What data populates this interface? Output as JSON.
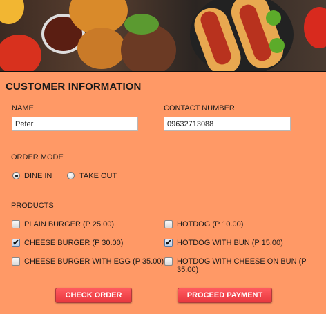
{
  "header": {
    "title": "CUSTOMER INFORMATION"
  },
  "name": {
    "label": "NAME",
    "value": "Peter"
  },
  "contact": {
    "label": "CONTACT NUMBER",
    "value": "09632713088"
  },
  "order_mode": {
    "label": "ORDER MODE",
    "options": [
      {
        "label": "DINE IN",
        "selected": true
      },
      {
        "label": "TAKE OUT",
        "selected": false
      }
    ]
  },
  "products": {
    "label": "PRODUCTS",
    "items": [
      {
        "label": "PLAIN BURGER (P 25.00)",
        "checked": false
      },
      {
        "label": "CHEESE BURGER (P 30.00)",
        "checked": true
      },
      {
        "label": "CHEESE BURGER WITH EGG (P 35.00)",
        "checked": false
      },
      {
        "label": "HOTDOG (P 10.00)",
        "checked": false
      },
      {
        "label": "HOTDOG WITH BUN (P 15.00)",
        "checked": true
      },
      {
        "label": "HOTDOG WITH CHEESE ON BUN (P 35.00)",
        "checked": false
      }
    ]
  },
  "buttons": {
    "check_order": "CHECK ORDER",
    "proceed_payment": "PROCEED PAYMENT"
  },
  "colors": {
    "background": "#FF9966",
    "button": "#F04449"
  }
}
